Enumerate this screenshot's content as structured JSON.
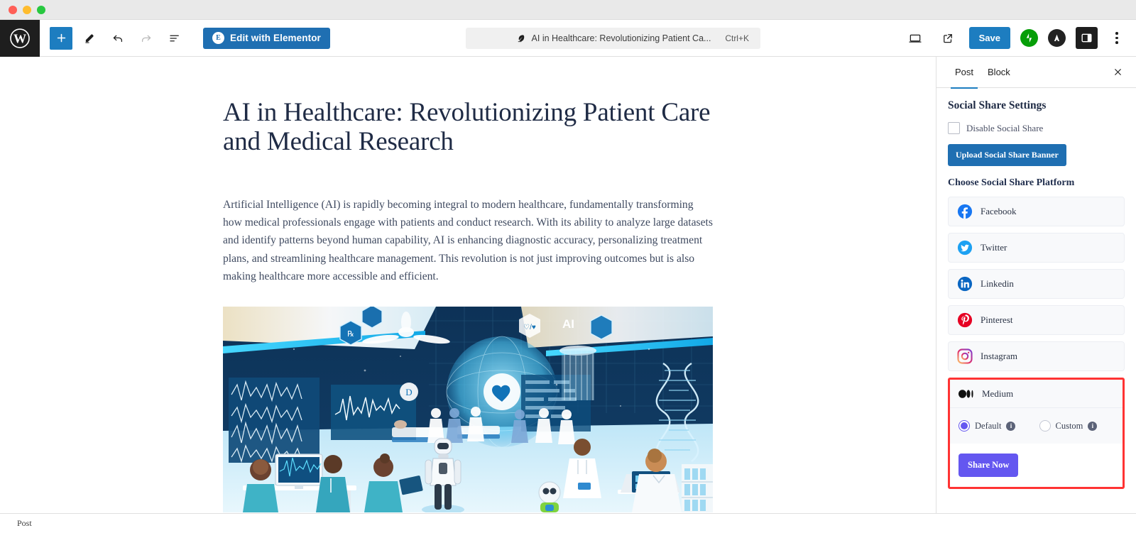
{
  "window": {
    "traffic_lights": [
      "close",
      "minimize",
      "maximize"
    ]
  },
  "toolbar": {
    "logo_icon": "wordpress-logo-icon",
    "add_block_label": "+",
    "tools_icon": "pencil-icon",
    "undo_icon": "undo-arrow-icon",
    "redo_icon": "redo-arrow-icon",
    "list_view_icon": "document-overview-icon",
    "elementor_label": "Edit with Elementor",
    "elementor_badge": "E",
    "command_palette_text": "AI in Healthcare: Revolutionizing Patient Ca...",
    "command_palette_icon": "feather-pen-icon",
    "command_palette_shortcut": "Ctrl+K",
    "view_icon": "desktop-view-icon",
    "preview_icon": "external-link-icon",
    "save_label": "Save",
    "jetpack_icon": "jetpack-icon",
    "astra_icon": "astra-icon",
    "sidebar_toggle_icon": "settings-sidebar-icon",
    "options_icon": "kebab-menu-icon"
  },
  "editor": {
    "title": "AI in Healthcare: Revolutionizing Patient Care and Medical Research",
    "paragraph": "Artificial Intelligence (AI) is rapidly becoming integral to modern healthcare, fundamentally transforming how medical professionals engage with patients and conduct research. With its ability to analyze large datasets and identify patterns beyond human capability, AI is enhancing diagnostic accuracy, personalizing treatment plans, and streamlining healthcare management. This revolution is not just improving outcomes but is also making healthcare more accessible and efficient.",
    "featured_image_alt": "Futuristic AI hospital ward with doctors, nurses, humanoid robot, holographic globe, DNA helix and ECG monitors"
  },
  "panel": {
    "tabs": [
      {
        "label": "Post",
        "active": true
      },
      {
        "label": "Block",
        "active": false
      }
    ],
    "close_icon": "close-icon",
    "section_title": "Social Share Settings",
    "disable_share": {
      "label": "Disable Social Share",
      "checked": false
    },
    "upload_button_label": "Upload Social Share Banner",
    "choose_platform_label": "Choose Social Share Platform",
    "platforms": [
      {
        "label": "Facebook",
        "icon": "facebook-icon",
        "color": "#1877f2"
      },
      {
        "label": "Twitter",
        "icon": "twitter-icon",
        "color": "#1da1f2"
      },
      {
        "label": "Linkedin",
        "icon": "linkedin-icon",
        "color": "#0a66c2"
      },
      {
        "label": "Pinterest",
        "icon": "pinterest-icon",
        "color": "#e60023"
      },
      {
        "label": "Instagram",
        "icon": "instagram-icon",
        "color": "#e1306c"
      }
    ],
    "medium": {
      "label": "Medium",
      "icon": "medium-icon",
      "highlighted": true,
      "highlight_color": "#ff3333",
      "options": [
        {
          "label": "Default",
          "selected": true,
          "info_icon": "info-icon"
        },
        {
          "label": "Custom",
          "selected": false,
          "info_icon": "info-icon"
        }
      ],
      "share_button_label": "Share Now",
      "share_button_color": "#6457f0"
    }
  },
  "statusbar": {
    "label": "Post"
  }
}
